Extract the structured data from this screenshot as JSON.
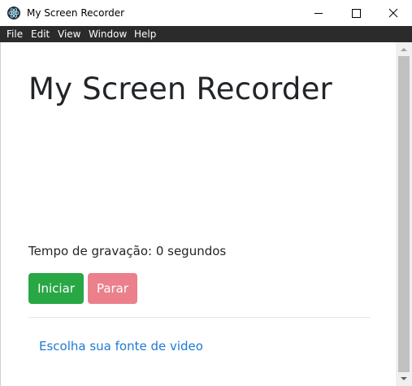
{
  "window": {
    "title": "My Screen Recorder",
    "app_icon": "electron-icon",
    "controls": [
      "minimize-icon",
      "maximize-icon",
      "close-icon"
    ]
  },
  "menu": {
    "items": [
      "File",
      "Edit",
      "View",
      "Window",
      "Help"
    ]
  },
  "main": {
    "heading": "My Screen Recorder",
    "record_time": "Tempo de gravação: 0 segundos",
    "start_label": "Iniciar",
    "stop_label": "Parar",
    "video_source_link": "Escolha sua fonte de video"
  },
  "colors": {
    "start_button": "#28a745",
    "stop_button": "#eb808c",
    "link": "#1d7ad4",
    "menubar": "#2b2b2b",
    "heading_text": "#212529"
  }
}
